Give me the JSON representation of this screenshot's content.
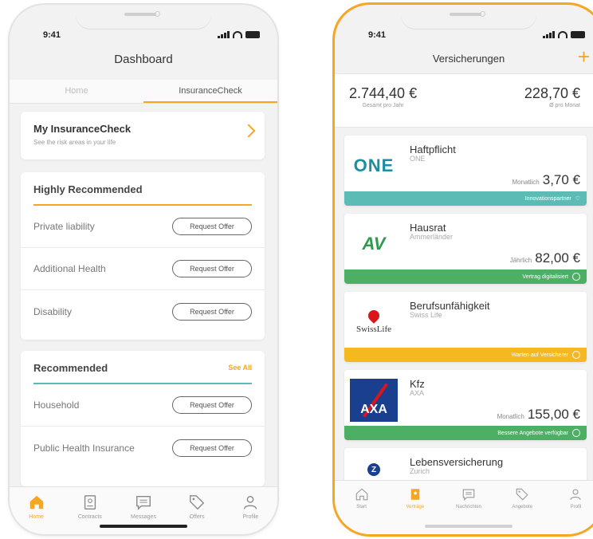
{
  "left_phone": {
    "status_time": "9:41",
    "title": "Dashboard",
    "tabs": [
      {
        "label": "Home",
        "active": false
      },
      {
        "label": "InsuranceCheck",
        "active": true
      }
    ],
    "my_check": {
      "title": "My InsuranceCheck",
      "subtitle": "See the risk areas in your life"
    },
    "highly_recommended": {
      "title": "Highly Recommended",
      "rows": [
        {
          "label": "Private liability",
          "button": "Request Offer"
        },
        {
          "label": "Additional Health",
          "button": "Request Offer"
        },
        {
          "label": "Disability",
          "button": "Request Offer"
        }
      ]
    },
    "recommended": {
      "title": "Recommended",
      "see_all": "See All",
      "rows": [
        {
          "label": "Household",
          "button": "Request Offer"
        },
        {
          "label": "Public Health Insurance",
          "button": "Request Offer"
        }
      ]
    },
    "tabbar": [
      {
        "label": "Home",
        "icon": "home-icon",
        "active": true
      },
      {
        "label": "Contracts",
        "icon": "contracts-icon",
        "active": false
      },
      {
        "label": "Messages",
        "icon": "messages-icon",
        "active": false
      },
      {
        "label": "Offers",
        "icon": "tag-icon",
        "active": false
      },
      {
        "label": "Profile",
        "icon": "profile-icon",
        "active": false
      }
    ]
  },
  "right_phone": {
    "status_time": "9:41",
    "title": "Versicherungen",
    "add_label": "+",
    "totals": {
      "yearly_value": "2.744,40 €",
      "yearly_caption": "Gesamt pro Jahr",
      "monthly_value": "228,70 €",
      "monthly_caption": "Ø pro Monat"
    },
    "insurances": [
      {
        "name": "Haftpflicht",
        "company": "ONE",
        "logo_text": "ONE",
        "period": "Monatlich",
        "amount": "3,70 €",
        "band": "Innovationspartner",
        "band_color": "#5cbcb5"
      },
      {
        "name": "Hausrat",
        "company": "Ammerländer",
        "logo_text": "AV",
        "period": "Jährlich",
        "amount": "82,00 €",
        "band": "Vertrag digitalisiert",
        "band_color": "#4caf64"
      },
      {
        "name": "Berufsunfähigkeit",
        "company": "Swiss Life",
        "logo_text": "SwissLife",
        "period": "",
        "amount": "",
        "band": "Warten auf Versicherer",
        "band_color": "#f5b820"
      },
      {
        "name": "Kfz",
        "company": "AXA",
        "logo_text": "AXA",
        "period": "Monatlich",
        "amount": "155,00 €",
        "band": "Bessere Angebote verfügbar",
        "band_color": "#4caf64"
      },
      {
        "name": "Lebensversicherung",
        "company": "Zurich",
        "logo_text": "Z"
      }
    ],
    "tabbar": [
      {
        "label": "Start",
        "icon": "home-icon",
        "active": false
      },
      {
        "label": "Verträge",
        "icon": "contracts-icon",
        "active": true
      },
      {
        "label": "Nachrichten",
        "icon": "messages-icon",
        "active": false
      },
      {
        "label": "Angebote",
        "icon": "tag-icon",
        "active": false
      },
      {
        "label": "Profil",
        "icon": "profile-icon",
        "active": false
      }
    ]
  },
  "colors": {
    "accent": "#f5a623",
    "teal": "#5cbcb5",
    "green": "#4caf64",
    "yellow": "#f5b820"
  }
}
